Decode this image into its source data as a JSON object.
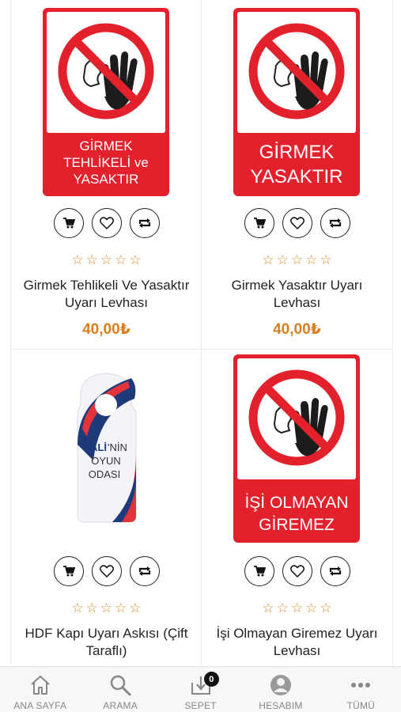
{
  "products": [
    {
      "name": "Girmek Tehlikeli Ve Yasaktır Uyarı Levhası",
      "price": "40,00₺",
      "sign_lines": [
        "GİRMEK",
        "TEHLİKELİ ve",
        "YASAKTIR"
      ]
    },
    {
      "name": "Girmek Yasaktır Uyarı Levhası",
      "price": "40,00₺",
      "sign_lines": [
        "GİRMEK",
        "YASAKTIR"
      ]
    },
    {
      "name": "HDF Kapı Uyarı Askısı (Çift Taraflı)",
      "price": "",
      "hanger_lines": [
        "ALİ",
        "'NİN",
        "OYUN",
        "ODASI"
      ]
    },
    {
      "name": "İşi Olmayan Giremez Uyarı Levhası",
      "price": "",
      "sign_lines": [
        "İŞİ OLMAYAN",
        "GİREMEZ"
      ]
    }
  ],
  "star_glyph": "☆",
  "colors": {
    "sign_red": "#e3212d",
    "price": "#d97f1f",
    "star": "#d98a2b"
  },
  "nav": {
    "items": [
      {
        "label": "ANA SAYFA",
        "icon": "home-icon"
      },
      {
        "label": "ARAMA",
        "icon": "search-icon"
      },
      {
        "label": "SEPET",
        "icon": "cart-download-icon",
        "badge": "0"
      },
      {
        "label": "HESABIM",
        "icon": "user-icon"
      },
      {
        "label": "TÜMÜ",
        "icon": "more-icon"
      }
    ]
  }
}
